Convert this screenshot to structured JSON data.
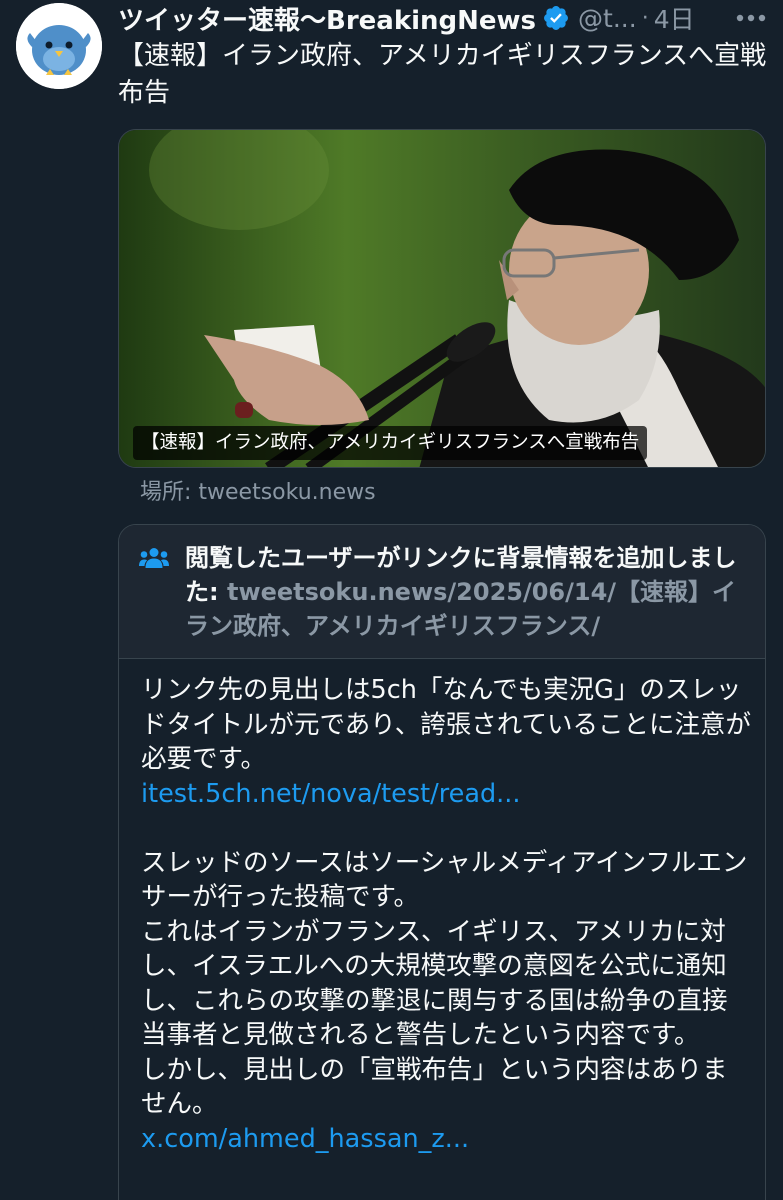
{
  "account": {
    "display_name": "ツイッター速報〜BreakingNews",
    "handle": "@t...",
    "separator": "·",
    "time": "4日",
    "verified_icon": "verified-badge-icon",
    "more_icon": "more-options-icon"
  },
  "tweet": {
    "text": "【速報】イラン政府、アメリカイギリスフランスへ宣戦布告"
  },
  "card": {
    "caption": "【速報】イラン政府、アメリカイギリスフランスへ宣戦布告",
    "location": "場所: tweetsoku.news"
  },
  "community_note": {
    "icon": "people-icon",
    "title_prefix": "閲覧したユーザーがリンクに背景情報を追加しました:",
    "title_link": "tweetsoku.news/2025/06/14/【速報】イラン政府、アメリカイギリスフランス/",
    "body_1": "リンク先の見出しは5ch「なんでも実況G」のスレッドタイトルが元であり、誇張されていることに注意が必要です。",
    "link_1": "itest.5ch.net/nova/test/read...",
    "body_2": "スレッドのソースはソーシャルメディアインフルエンサーが行った投稿です。",
    "body_3": "これはイランがフランス、イギリス、アメリカに対し、イスラエルへの大規模攻撃の意図を公式に通知し、これらの攻撃の撃退に関与する国は紛争の直接当事者と見做されると警告したという内容です。",
    "body_4": "しかし、見出しの「宣戦布告」という内容はありません。",
    "link_2": "x.com/ahmed_hassan_z..."
  },
  "colors": {
    "background": "#15202b",
    "text": "#f7f9f9",
    "muted": "#8b98a5",
    "link": "#1d9bf0",
    "border": "#38444d",
    "note_header": "#1e2732"
  }
}
